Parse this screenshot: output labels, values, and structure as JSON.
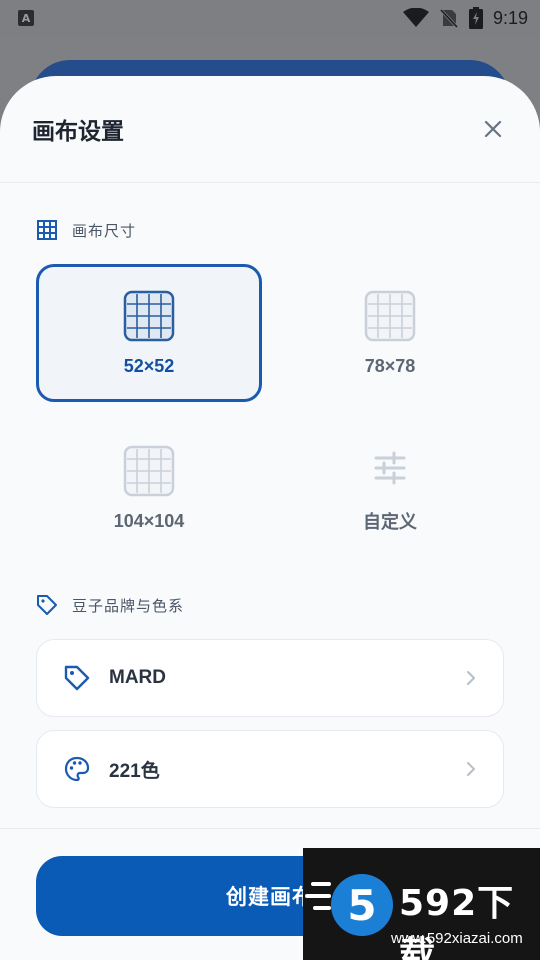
{
  "status_bar": {
    "time": "9:19",
    "notification_icon": "A"
  },
  "sheet": {
    "title": "画布设置",
    "size_section": {
      "label": "画布尺寸",
      "options": [
        {
          "label": "52×52",
          "selected": true
        },
        {
          "label": "78×78",
          "selected": false
        },
        {
          "label": "104×104",
          "selected": false
        },
        {
          "label": "自定义",
          "selected": false
        }
      ]
    },
    "brand_section": {
      "label": "豆子品牌与色系",
      "brand": "MARD",
      "palette": "221色"
    },
    "create_button": "创建画布"
  },
  "watermark": {
    "brand": "592下载",
    "logo_digit": "5",
    "url": "www.592xiazai.com"
  },
  "colors": {
    "accent": "#0a5bb5",
    "selected_border": "#1a5bb0",
    "background": "#f8fafc"
  }
}
